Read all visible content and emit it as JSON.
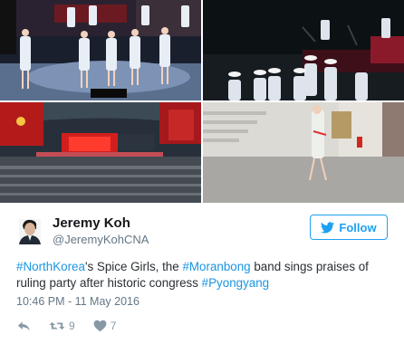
{
  "colors": {
    "link": "#1b95e0",
    "follow_accent": "#1da1f2",
    "secondary_text": "#657786",
    "action_icons": "#8899a6"
  },
  "media": [
    {
      "icon": "photo-stage-performers-blue-uniforms"
    },
    {
      "icon": "photo-band-playing-instruments"
    },
    {
      "icon": "photo-arena-crowd-red-banners"
    },
    {
      "icon": "photo-performer-walking-hallway"
    }
  ],
  "user": {
    "name": "Jeremy Koh",
    "handle": "@JeremyKohCNA",
    "avatar_icon": "profile-photo"
  },
  "follow_button": {
    "label": "Follow",
    "icon": "twitter-bird-icon"
  },
  "tweet": {
    "segments": [
      {
        "text": "#NorthKorea",
        "hashtag": true
      },
      {
        "text": "'s Spice Girls, the ",
        "hashtag": false
      },
      {
        "text": "#Moranbong",
        "hashtag": true
      },
      {
        "text": " band sings praises of ruling party after historic congress ",
        "hashtag": false
      },
      {
        "text": "#Pyongyang",
        "hashtag": true
      }
    ],
    "timestamp": "10:46 PM - 11 May 2016"
  },
  "actions": {
    "reply": {
      "icon": "reply-icon"
    },
    "retweet": {
      "icon": "retweet-icon",
      "count": "9"
    },
    "like": {
      "icon": "heart-icon",
      "count": "7"
    }
  }
}
